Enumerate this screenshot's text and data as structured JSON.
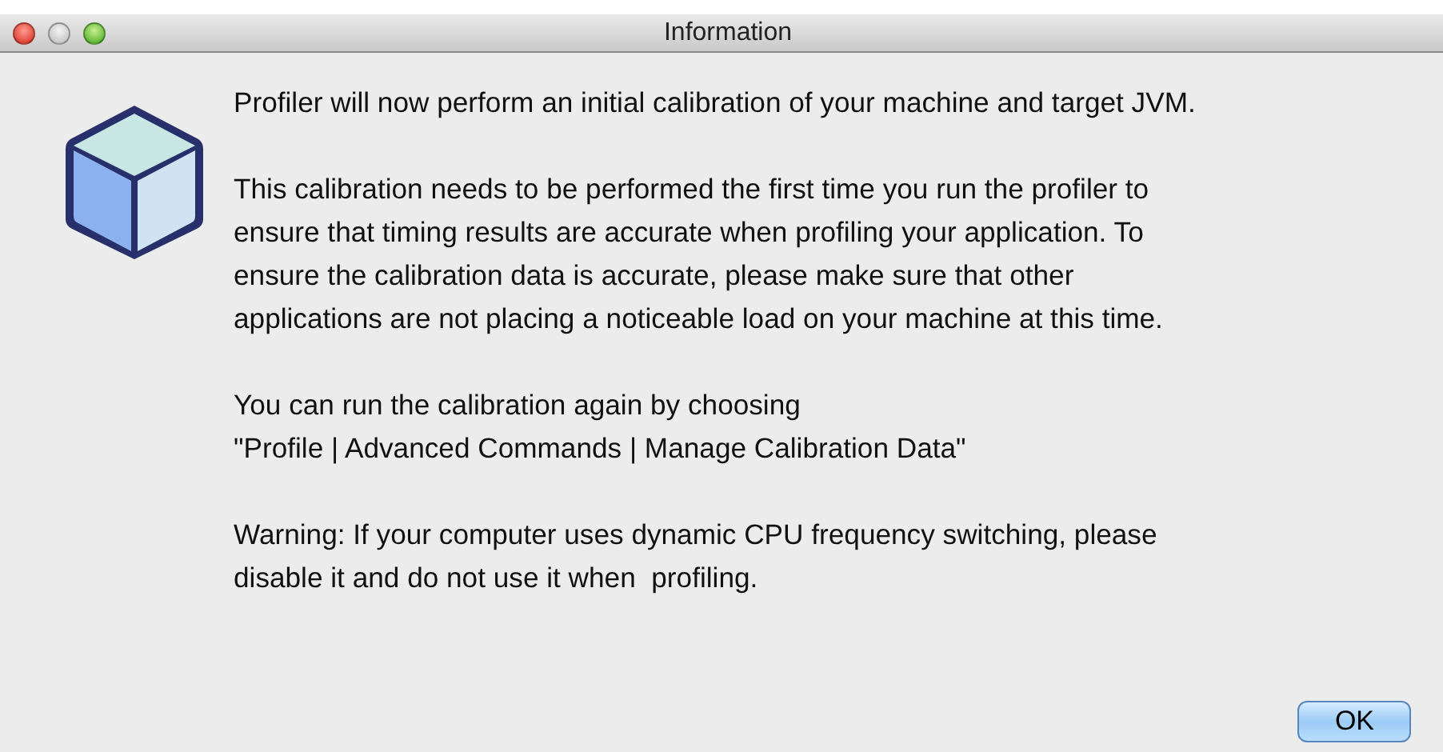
{
  "window": {
    "title": "Information"
  },
  "paragraphs": [
    {
      "lines": [
        "Profiler will now perform an initial calibration of your machine and target JVM."
      ]
    },
    {
      "lines": [
        "This calibration needs to be performed the first time you run the profiler to",
        "ensure that timing results are accurate when profiling your application. To",
        "ensure the calibration data is accurate, please make sure that other",
        "applications are not placing a noticeable load on your machine at this time."
      ]
    },
    {
      "lines": [
        "You can run the calibration again by choosing",
        "\"Profile | Advanced Commands | Manage Calibration Data\""
      ]
    },
    {
      "lines": [
        "Warning: If your computer uses dynamic CPU frequency switching, please",
        "disable it and do not use it when  profiling."
      ]
    }
  ],
  "buttons": [
    {
      "label": "OK",
      "default": true
    }
  ]
}
